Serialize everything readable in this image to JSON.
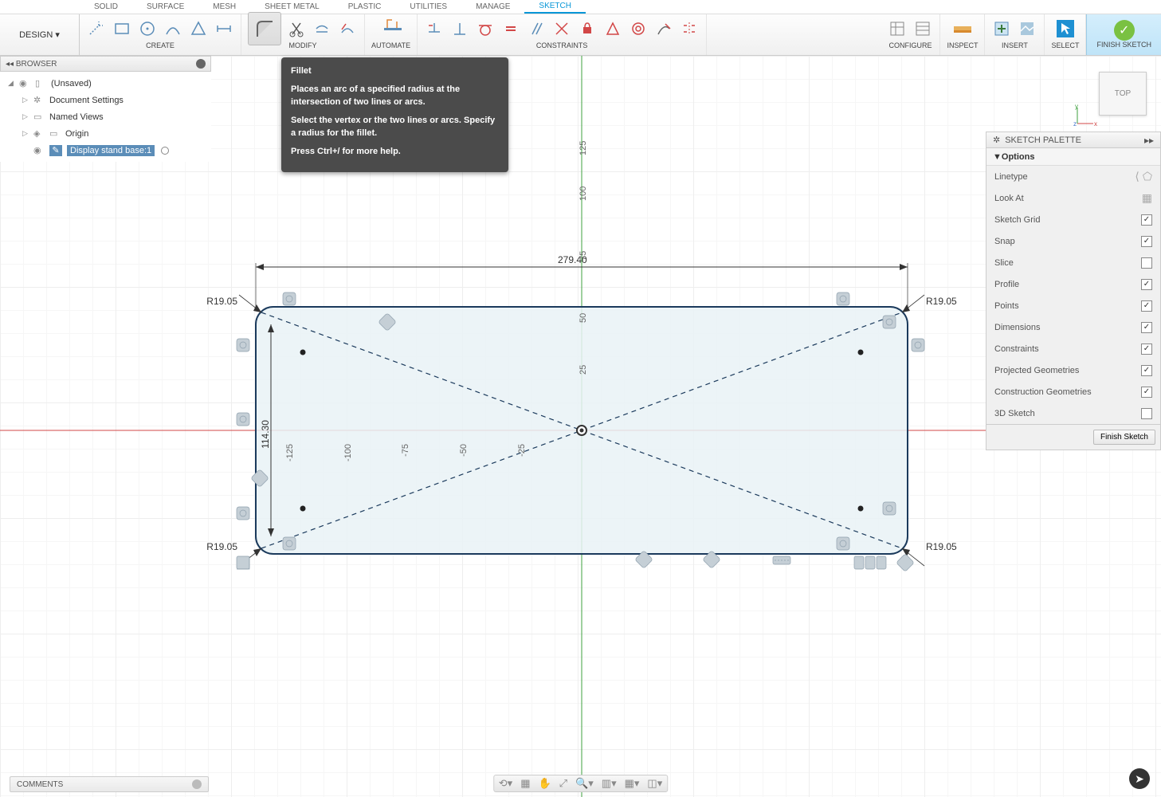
{
  "design_label": "DESIGN",
  "tabs": [
    "SOLID",
    "SURFACE",
    "MESH",
    "SHEET METAL",
    "PLASTIC",
    "UTILITIES",
    "MANAGE",
    "SKETCH"
  ],
  "active_tab": "SKETCH",
  "groups": {
    "create": "CREATE",
    "modify": "MODIFY",
    "automate": "AUTOMATE",
    "constraints": "CONSTRAINTS",
    "configure": "CONFIGURE",
    "inspect": "INSPECT",
    "insert": "INSERT",
    "select": "SELECT",
    "finish": "FINISH SKETCH"
  },
  "tooltip": {
    "title": "Fillet",
    "p1": "Places an arc of a specified radius at the intersection of two lines or arcs.",
    "p2": "Select the vertex or the two lines or arcs. Specify a radius for the fillet.",
    "p3": "Press Ctrl+/ for more help."
  },
  "browser": {
    "title": "BROWSER",
    "root": "(Unsaved)",
    "items": [
      "Document Settings",
      "Named Views",
      "Origin",
      "Display stand base:1"
    ]
  },
  "palette": {
    "title": "SKETCH PALETTE",
    "section": "Options",
    "rows": [
      {
        "label": "Linetype",
        "type": "icons"
      },
      {
        "label": "Look At",
        "type": "icon"
      },
      {
        "label": "Sketch Grid",
        "type": "check",
        "checked": true
      },
      {
        "label": "Snap",
        "type": "check",
        "checked": true
      },
      {
        "label": "Slice",
        "type": "check",
        "checked": false
      },
      {
        "label": "Profile",
        "type": "check",
        "checked": true
      },
      {
        "label": "Points",
        "type": "check",
        "checked": true
      },
      {
        "label": "Dimensions",
        "type": "check",
        "checked": true
      },
      {
        "label": "Constraints",
        "type": "check",
        "checked": true
      },
      {
        "label": "Projected Geometries",
        "type": "check",
        "checked": true
      },
      {
        "label": "Construction Geometries",
        "type": "check",
        "checked": true
      },
      {
        "label": "3D Sketch",
        "type": "check",
        "checked": false
      }
    ],
    "finish_btn": "Finish Sketch"
  },
  "viewcube": "TOP",
  "comments": "COMMENTS",
  "sketch": {
    "width_dim": "279.40",
    "height_dim": "114.30",
    "fillet_radius": "R19.05",
    "ruler_y": [
      "125",
      "100",
      "75",
      "50",
      "25"
    ],
    "ruler_x": [
      "-125",
      "-100",
      "-75",
      "-50",
      "-25"
    ]
  }
}
